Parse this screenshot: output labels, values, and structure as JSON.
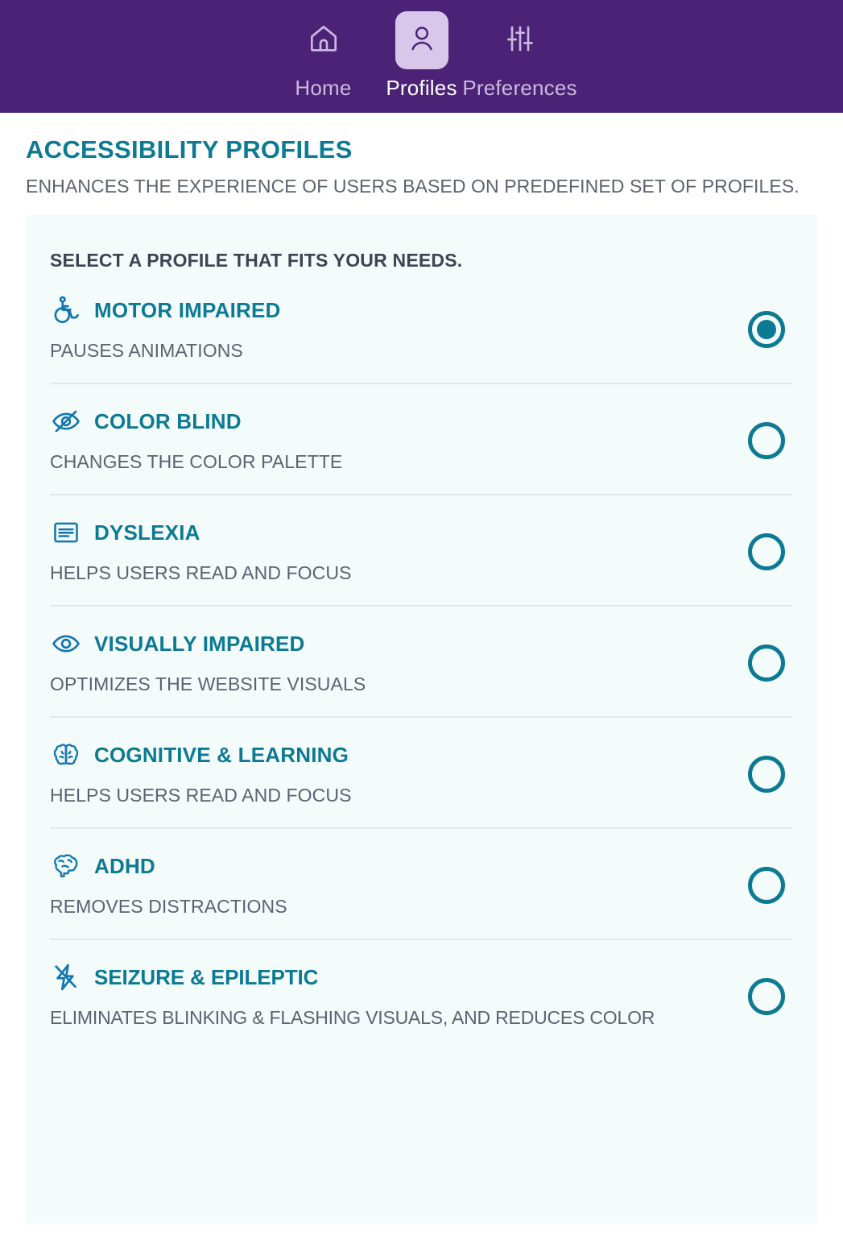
{
  "nav": {
    "items": [
      {
        "label": "Home",
        "icon": "home-icon",
        "active": false
      },
      {
        "label": "Profiles",
        "icon": "person-icon",
        "active": true
      },
      {
        "label": "Preferences",
        "icon": "sliders-icon",
        "active": false
      }
    ],
    "background_color": "#4b2275",
    "active_badge_color": "#d8c7ea",
    "active_label_color": "#ffffff",
    "inactive_label_color": "#cbb9df"
  },
  "page": {
    "title": "ACCESSIBILITY PROFILES",
    "subtitle": "ENHANCES THE EXPERIENCE OF USERS BASED ON PREDEFINED SET OF PROFILES.",
    "title_color": "#0c7a93",
    "subtitle_color": "#5c6270"
  },
  "card": {
    "heading": "SELECT A PROFILE THAT FITS YOUR NEEDS.",
    "background_color": "#f4fbfb",
    "divider_color": "#e4e8ea",
    "profiles": [
      {
        "title": "MOTOR IMPAIRED",
        "description": "PAUSES ANIMATIONS",
        "icon": "wheelchair-icon",
        "selected": true
      },
      {
        "title": "COLOR BLIND",
        "description": "CHANGES THE COLOR PALETTE",
        "icon": "eye-off-icon",
        "selected": false
      },
      {
        "title": "DYSLEXIA",
        "description": "HELPS USERS READ AND FOCUS",
        "icon": "text-lines-icon",
        "selected": false
      },
      {
        "title": "VISUALLY IMPAIRED",
        "description": "OPTIMIZES THE WEBSITE VISUALS",
        "icon": "eye-icon",
        "selected": false
      },
      {
        "title": "COGNITIVE & LEARNING",
        "description": "HELPS USERS READ AND FOCUS",
        "icon": "brain-front-icon",
        "selected": false
      },
      {
        "title": "ADHD",
        "description": "REMOVES DISTRACTIONS",
        "icon": "brain-side-icon",
        "selected": false
      },
      {
        "title": "SEIZURE & EPILEPTIC",
        "description": "ELIMINATES BLINKING & FLASHING VISUALS, AND REDUCES COLOR",
        "icon": "bolt-slash-icon",
        "selected": false
      }
    ]
  },
  "colors": {
    "accent_teal": "#0c7a93",
    "icon_blue": "#1277b0",
    "purple": "#4b2275"
  }
}
